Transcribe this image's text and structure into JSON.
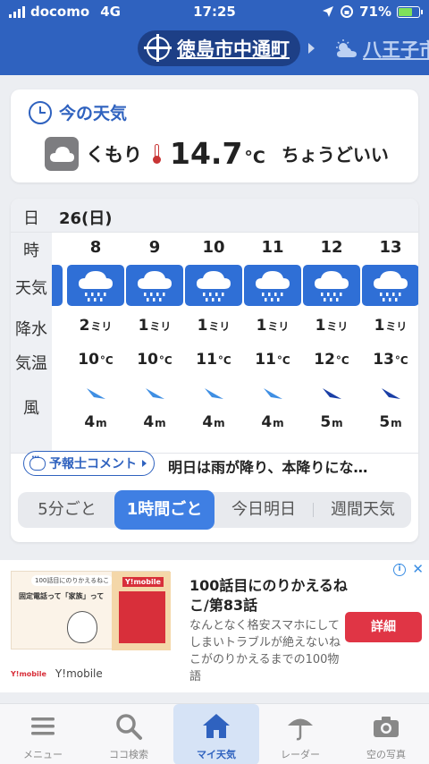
{
  "status_bar": {
    "carrier": "docomo",
    "network": "4G",
    "time": "17:25",
    "battery": "71%",
    "battery_level": 0.71
  },
  "header": {
    "location": "徳島市中通町",
    "next_location": "八王子市"
  },
  "current": {
    "title": "今の天気",
    "condition": "くもり",
    "temperature": "14.7",
    "unit": "°C",
    "comment": "ちょうどいい"
  },
  "hourly": {
    "labels": {
      "day": "日",
      "hour": "時",
      "weather": "天気",
      "precip": "降水",
      "temp": "気温",
      "wind": "風"
    },
    "day_value": "26(日)",
    "precip_unit": "ミリ",
    "temp_unit": "°C",
    "wind_unit": "m",
    "hours": [
      {
        "hour": "8",
        "weather": "rain",
        "precip": "2",
        "temp": "10",
        "wind_dir": "northwest",
        "wind_speed": "4"
      },
      {
        "hour": "9",
        "weather": "rain",
        "precip": "1",
        "temp": "10",
        "wind_dir": "northwest",
        "wind_speed": "4"
      },
      {
        "hour": "10",
        "weather": "rain",
        "precip": "1",
        "temp": "11",
        "wind_dir": "northwest",
        "wind_speed": "4"
      },
      {
        "hour": "11",
        "weather": "rain",
        "precip": "1",
        "temp": "11",
        "wind_dir": "northwest",
        "wind_speed": "4"
      },
      {
        "hour": "12",
        "weather": "rain",
        "precip": "1",
        "temp": "12",
        "wind_dir": "northwest",
        "wind_speed": "5"
      },
      {
        "hour": "13",
        "weather": "rain",
        "precip": "1",
        "temp": "13",
        "wind_dir": "northwest",
        "wind_speed": "5"
      }
    ],
    "comment_button": "予報士コメント",
    "comment_text": "明日は雨が降り、本降りにな…",
    "tabs": [
      "5分ごと",
      "1時間ごと",
      "今日明日",
      "週間天気"
    ],
    "active_tab": 1
  },
  "ad": {
    "title": "100話目にのりかえるねこ/第83話",
    "description": "なんとなく格安スマホにしてしまいトラブルが絶えないねこがのりかえるまでの100物語",
    "cta": "詳細",
    "brand": "Y!mobile",
    "image_caption": "100話目にのりかえるねこ",
    "image_text": "固定電話って「家族」って",
    "image_badge": "Y!mobile",
    "close": "✕",
    "info": "i"
  },
  "bottom_nav": {
    "items": [
      {
        "label": "メニュー",
        "icon": "menu-icon"
      },
      {
        "label": "ココ検索",
        "icon": "search-icon"
      },
      {
        "label": "マイ天気",
        "icon": "home-icon"
      },
      {
        "label": "レーダー",
        "icon": "umbrella-icon"
      },
      {
        "label": "空の写真",
        "icon": "camera-icon"
      }
    ],
    "active_index": 2
  },
  "colors": {
    "header_blue": "#2f62bf",
    "weather_tile_blue": "#2f6fd6",
    "accent_blue": "#3f7fe3",
    "cta_red": "#e03545"
  }
}
